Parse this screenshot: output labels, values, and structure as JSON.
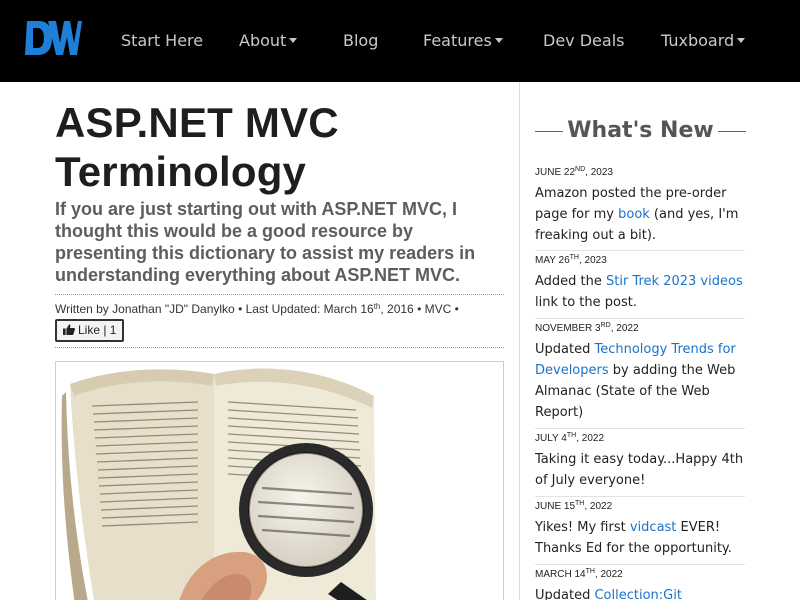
{
  "navbar": {
    "logo_alt": "DW",
    "items": [
      {
        "label": "Start Here",
        "dropdown": false
      },
      {
        "label": "About",
        "dropdown": true
      },
      {
        "label": "Blog",
        "dropdown": false
      },
      {
        "label": "Features",
        "dropdown": true
      },
      {
        "label": "Dev Deals",
        "dropdown": false
      },
      {
        "label": "Tuxboard",
        "dropdown": true
      }
    ]
  },
  "article": {
    "title": "ASP.NET MVC Terminology",
    "subtitle": "If you are just starting out with ASP.NET MVC, I thought this would be a good resource by presenting this dictionary to assist my readers in understanding everything about ASP.NET MVC.",
    "meta": {
      "written_by_prefix": "Written by ",
      "author": "Jonathan \"JD\" Danylko",
      "separator": " • ",
      "updated_prefix": "Last Updated: March 16",
      "updated_suffix": "th",
      "updated_year": ", 2016",
      "category": "MVC",
      "trailing": " •"
    },
    "like_label": "Like | 1"
  },
  "sidebar": {
    "title": "What's New",
    "items": [
      {
        "date_pre": "June 22",
        "date_sup": "nd",
        "date_post": ", 2023",
        "parts": [
          {
            "t": "Amazon posted the pre-order page for my "
          },
          {
            "t": "book",
            "link": true
          },
          {
            "t": " (and yes, I'm freaking out a bit)."
          }
        ]
      },
      {
        "date_pre": "May 26",
        "date_sup": "th",
        "date_post": ", 2023",
        "parts": [
          {
            "t": "Added the "
          },
          {
            "t": "Stir Trek 2023 videos",
            "link": true
          },
          {
            "t": " link to the post."
          }
        ]
      },
      {
        "date_pre": "November 3",
        "date_sup": "rd",
        "date_post": ", 2022",
        "parts": [
          {
            "t": "Updated "
          },
          {
            "t": "Technology Trends for Developers",
            "link": true
          },
          {
            "t": " by adding the Web Almanac (State of the Web Report)"
          }
        ]
      },
      {
        "date_pre": "July 4",
        "date_sup": "th",
        "date_post": ", 2022",
        "parts": [
          {
            "t": "Taking it easy today...Happy 4th of July everyone!"
          }
        ]
      },
      {
        "date_pre": "June 15",
        "date_sup": "th",
        "date_post": ", 2022",
        "parts": [
          {
            "t": "Yikes! My first "
          },
          {
            "t": "vidcast",
            "link": true
          },
          {
            "t": " EVER! Thanks Ed for the opportunity."
          }
        ]
      },
      {
        "date_pre": "March 14",
        "date_sup": "th",
        "date_post": ", 2022",
        "parts": [
          {
            "t": "Updated "
          },
          {
            "t": "Collection:Git Resources",
            "link": true
          }
        ]
      }
    ]
  },
  "colors": {
    "navbar_bg": "#000000",
    "nav_text": "#c9c9c9",
    "logo_blue": "#1f7fd8",
    "link": "#1a73c8",
    "title": "#1e1e1e",
    "subtitle": "#5d5d5d"
  }
}
